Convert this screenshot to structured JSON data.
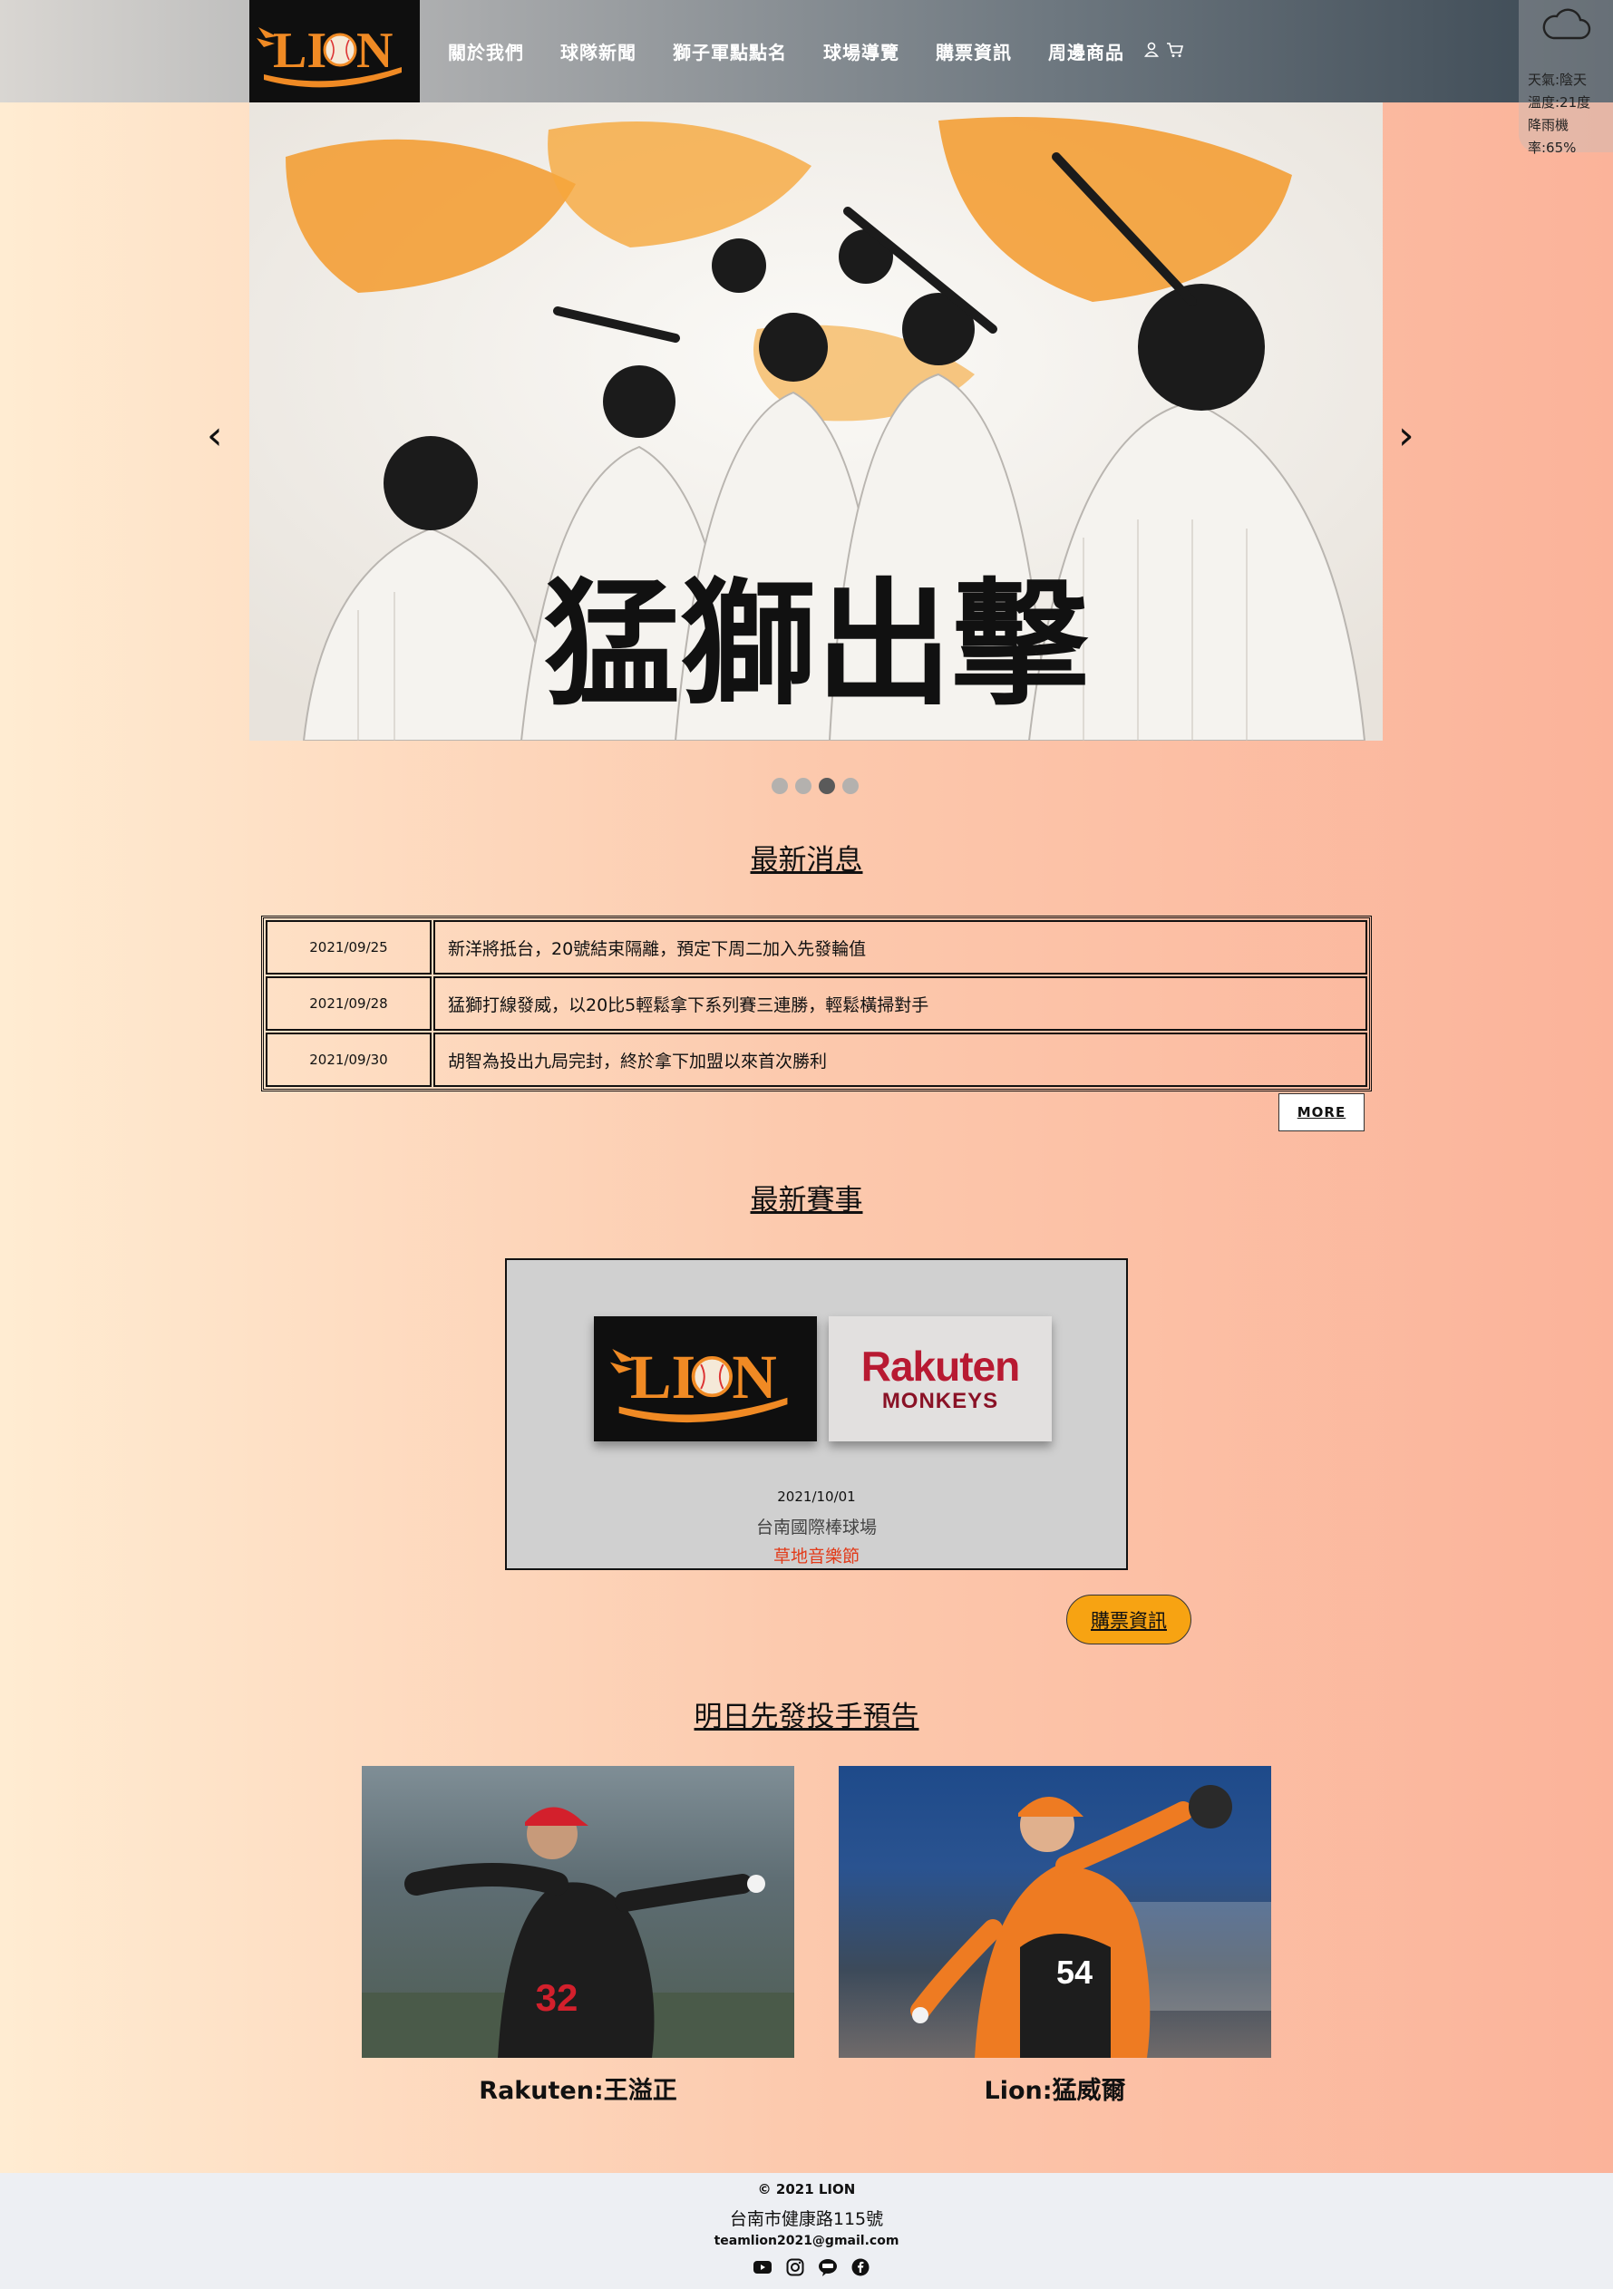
{
  "header": {
    "logo_text": "LION",
    "nav": [
      "關於我們",
      "球隊新聞",
      "獅子軍點點名",
      "球場導覽",
      "購票資訊",
      "周邊商品"
    ],
    "icons": [
      "user-icon",
      "cart-icon"
    ]
  },
  "weather": {
    "icon": "cloud-icon",
    "line1": "天氣:陰天",
    "line2": "溫度:21度",
    "line3": "降雨機率:65%"
  },
  "carousel": {
    "banner_text": "猛獅出擊",
    "prev": "‹",
    "next": "›",
    "slides": 4,
    "active_slide": 3
  },
  "news": {
    "title": "最新消息",
    "items": [
      {
        "date": "2021/09/25",
        "text": "新洋將抵台，20號結束隔離，預定下周二加入先發輪值"
      },
      {
        "date": "2021/09/28",
        "text": "猛獅打線發威，以20比5輕鬆拿下系列賽三連勝，輕鬆橫掃對手"
      },
      {
        "date": "2021/09/30",
        "text": "胡智為投出九局完封，終於拿下加盟以來首次勝利"
      }
    ],
    "more": "MORE"
  },
  "match": {
    "title": "最新賽事",
    "home_logo": "LION",
    "away_logo_main": "Rakuten",
    "away_logo_sub": "MONKEYS",
    "date": "2021/10/01",
    "venue": "台南國際棒球場",
    "event": "草地音樂節",
    "ticket": "購票資訊"
  },
  "pitchers": {
    "title": "明日先發投手預告",
    "items": [
      {
        "name": "Rakuten:王溢正",
        "jersey": "32"
      },
      {
        "name": "Lion:猛威爾",
        "jersey": "54"
      }
    ]
  },
  "footer": {
    "copyright": "© 2021 LION",
    "address": "台南市健康路115號",
    "email": "teamlion2021@gmail.com",
    "social": [
      "youtube-icon",
      "instagram-icon",
      "line-icon",
      "facebook-icon"
    ]
  }
}
